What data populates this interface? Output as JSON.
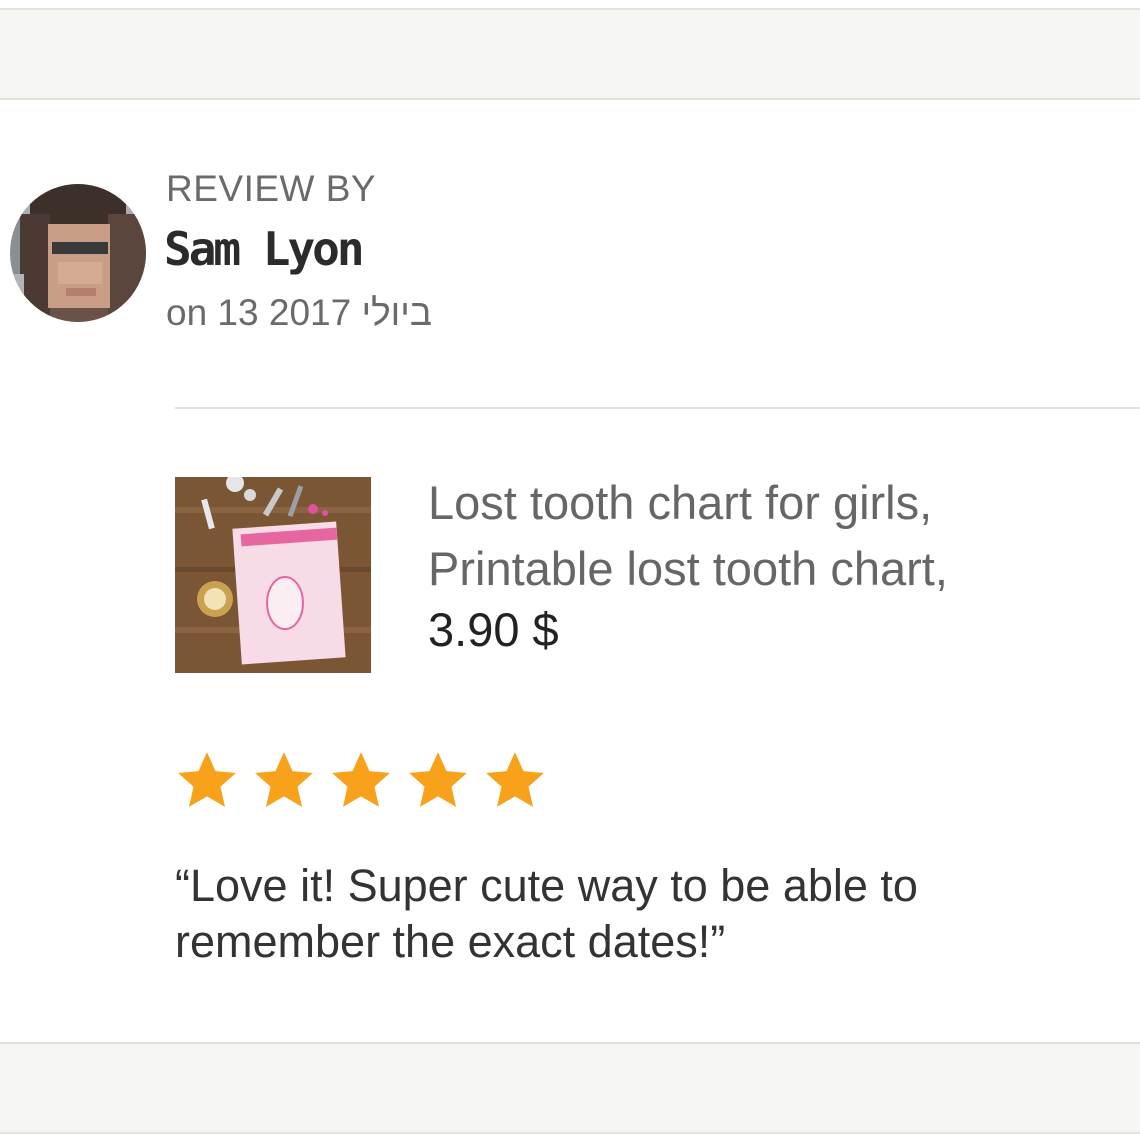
{
  "review": {
    "header_label": "REVIEW BY",
    "reviewer_name": "Sam Lyon",
    "date": "on 13 ביולי 2017",
    "rating": 5,
    "rating_max": 5,
    "text_lines": [
      "“Love it! Super cute way to be able to",
      "remember the exact dates!”"
    ]
  },
  "product": {
    "title_lines": [
      "Lost tooth chart for girls,",
      "Printable lost tooth chart,"
    ],
    "price": "3.90 $"
  },
  "colors": {
    "star": "#f8a21c",
    "band_background": "#f5f5f1",
    "divider": "#e2e2e2"
  },
  "icons": {
    "star": "star-icon",
    "avatar": "reviewer-avatar",
    "thumbnail": "product-thumbnail"
  }
}
